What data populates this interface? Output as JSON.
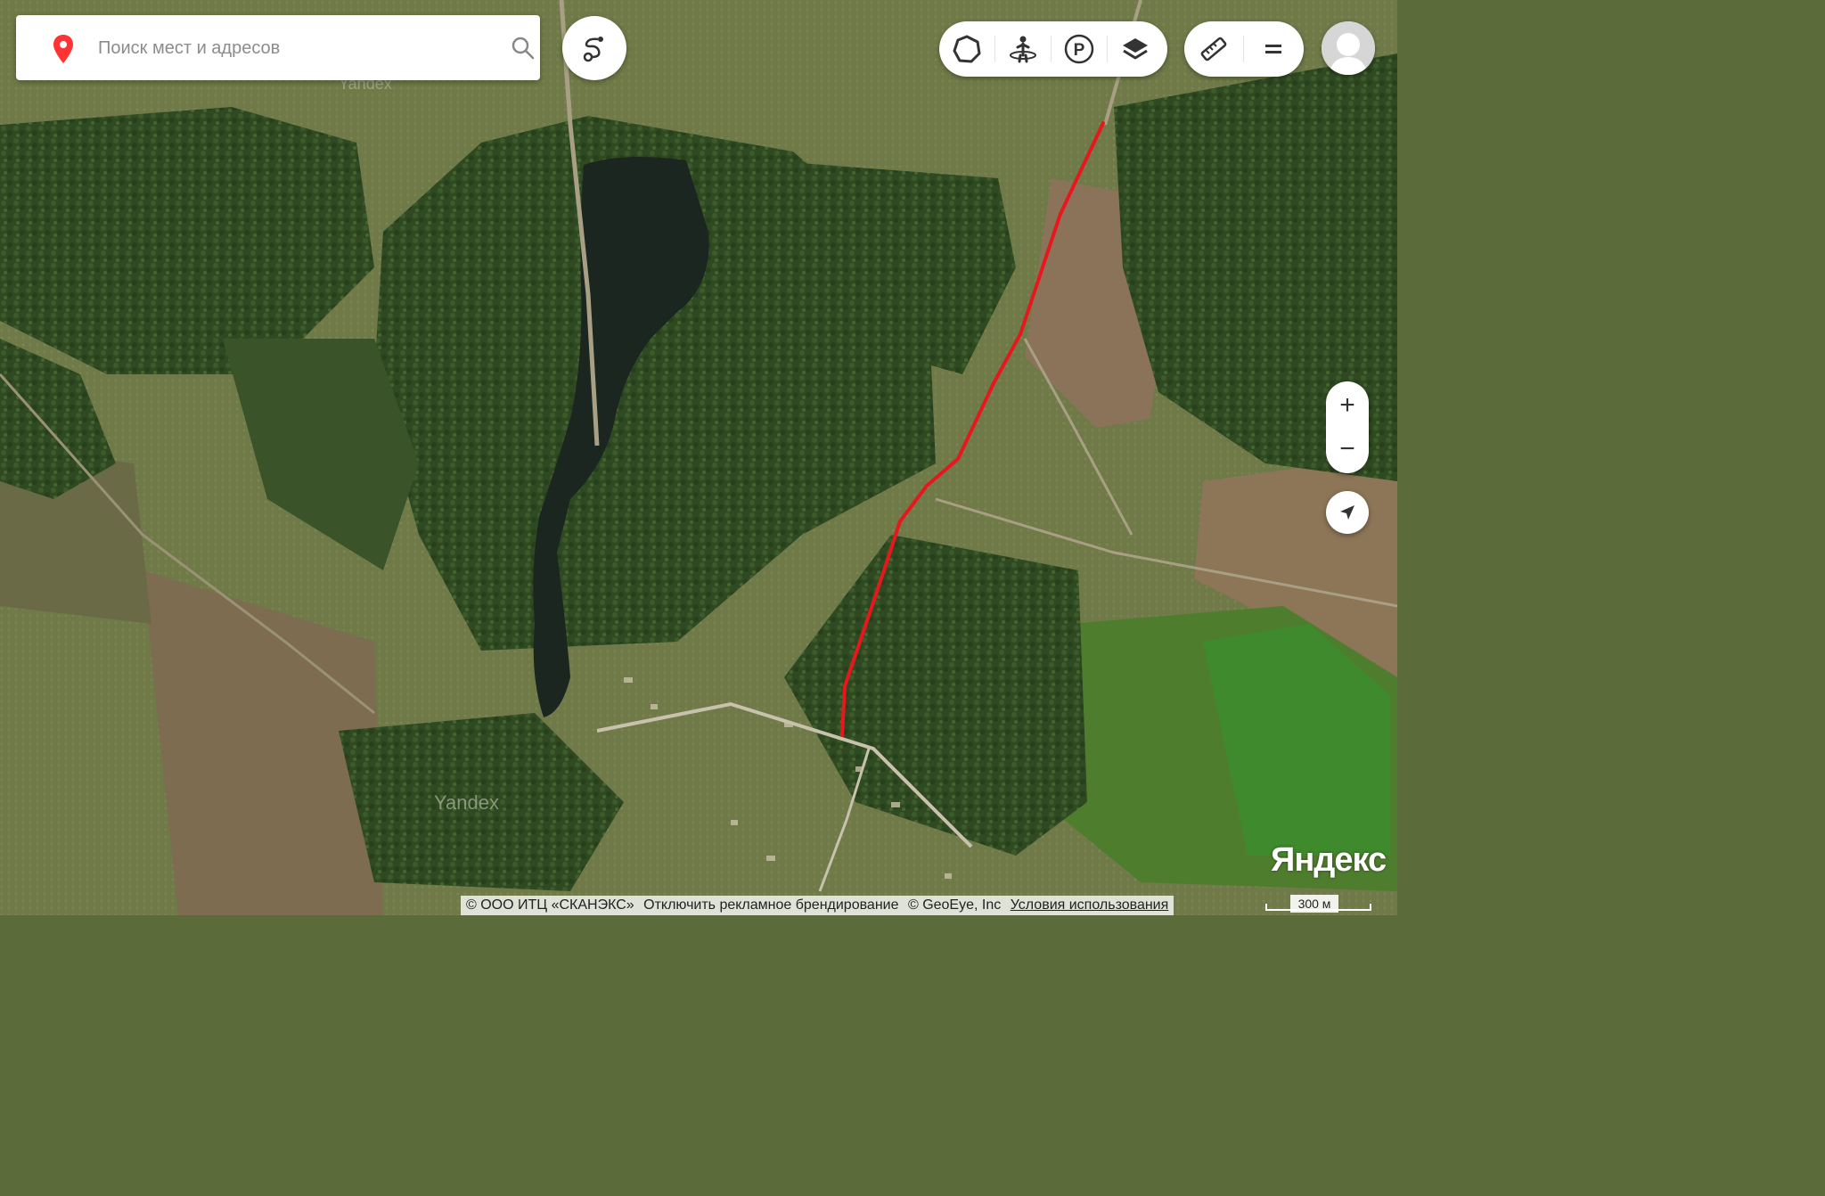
{
  "search": {
    "placeholder": "Поиск мест и адресов"
  },
  "icons": {
    "pin": "location-pin-icon",
    "search": "magnifier-icon",
    "route": "route-icon",
    "traffic": "traffic-circle-icon",
    "panorama": "panorama-person-icon",
    "parking": "parking-icon",
    "layers": "layers-icon",
    "ruler": "ruler-icon",
    "menu": "menu-icon",
    "zoom_in": "plus-icon",
    "zoom_out": "minus-icon",
    "locate": "location-arrow-icon"
  },
  "controls": {
    "zoom_in": "+",
    "zoom_out": "−"
  },
  "map": {
    "type": "satellite",
    "watermarks": [
      "Yandex",
      "Yandex"
    ],
    "route_color": "#e8171d"
  },
  "logo": "Яндекс",
  "scale": "300 м",
  "attribution": {
    "copyright": "© ООО ИТЦ «СКАНЭКС»",
    "branding": "Отключить рекламное брендирование",
    "provider": "© GeoEye, Inc",
    "terms": "Условия использования"
  },
  "colors": {
    "accent_red": "#f33",
    "route": "#e8171d"
  }
}
